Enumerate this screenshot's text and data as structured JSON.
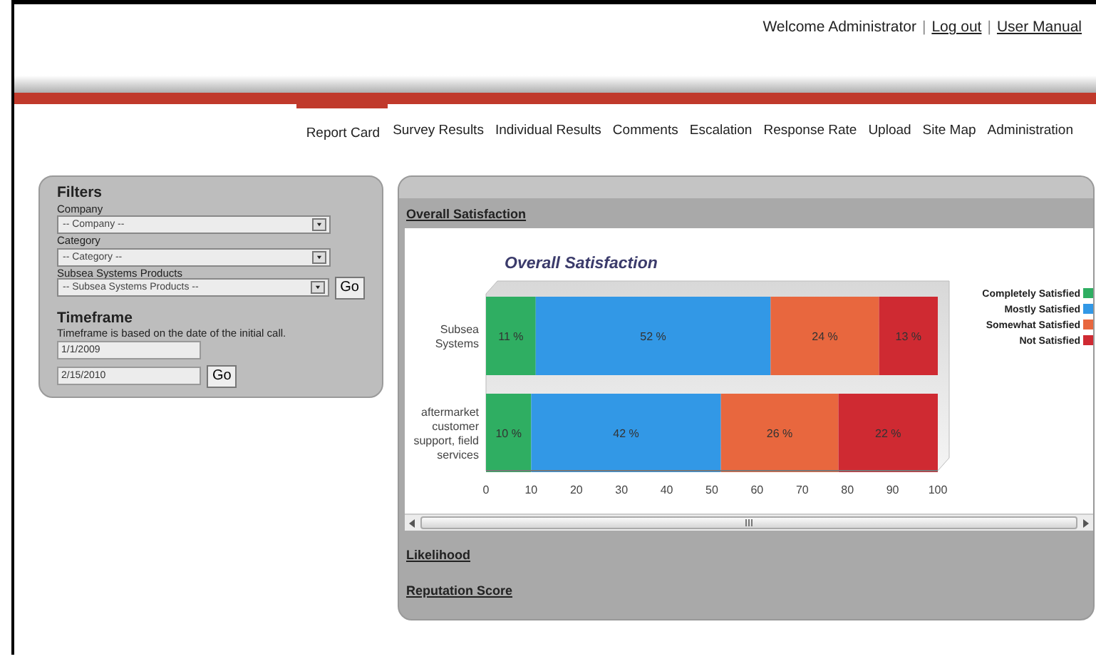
{
  "header": [
    {
      "kind": "text",
      "text": "Welcome Administrator"
    },
    {
      "kind": "sep",
      "text": "|"
    },
    {
      "kind": "link",
      "text": "Log out"
    },
    {
      "kind": "sep",
      "text": "|"
    },
    {
      "kind": "link",
      "text": "User Manual"
    }
  ],
  "nav": [
    {
      "label": "Report Card",
      "selected": true
    },
    {
      "label": "Survey Results",
      "selected": false
    },
    {
      "label": "Individual Results",
      "selected": false
    },
    {
      "label": "Comments",
      "selected": false
    },
    {
      "label": "Escalation",
      "selected": false
    },
    {
      "label": "Response Rate",
      "selected": false
    },
    {
      "label": "Upload",
      "selected": false
    },
    {
      "label": "Site Map",
      "selected": false
    },
    {
      "label": "Administration",
      "selected": false
    }
  ],
  "filters": {
    "title": "Filters",
    "fields": [
      {
        "label": "Company",
        "value": "-- Company --"
      },
      {
        "label": "Category",
        "value": "-- Category --"
      },
      {
        "label": "Subsea Systems Products",
        "value": "-- Subsea Systems Products --",
        "button": "Go"
      }
    ]
  },
  "timeframe": {
    "title": "Timeframe",
    "note": "Timeframe is based on the date of the initial call.",
    "start": "1/1/2009",
    "end": "2/15/2010",
    "button": "Go"
  },
  "report": {
    "sections": [
      {
        "title": "Overall Satisfaction",
        "chart_data": {
          "type": "bar",
          "orientation": "horizontal",
          "stacked": true,
          "title": "Overall Satisfaction",
          "categories": [
            "Subsea Systems",
            "aftermarket customer support, field services"
          ],
          "series": [
            {
              "name": "Completely Satisfied",
              "color": "#2fae62",
              "values": [
                11,
                10
              ],
              "value_labels": [
                "11 %",
                "10 %"
              ]
            },
            {
              "name": "Mostly Satisfied",
              "color": "#3298e6",
              "values": [
                52,
                42
              ],
              "value_labels": [
                "52 %",
                "42 %"
              ]
            },
            {
              "name": "Somewhat Satisfied",
              "color": "#e8673e",
              "values": [
                24,
                26
              ],
              "value_labels": [
                "24 %",
                "26 %"
              ]
            },
            {
              "name": "Not Satisfied",
              "color": "#cf2a32",
              "values": [
                13,
                22
              ],
              "value_labels": [
                "13 %",
                "22 %"
              ]
            }
          ],
          "legend": true,
          "xlim": [
            0,
            100
          ],
          "xticks": [
            0,
            10,
            20,
            30,
            40,
            50,
            60,
            70,
            80,
            90,
            100
          ]
        }
      },
      {
        "title": "Likelihood"
      },
      {
        "title": "Reputation Score"
      }
    ]
  }
}
